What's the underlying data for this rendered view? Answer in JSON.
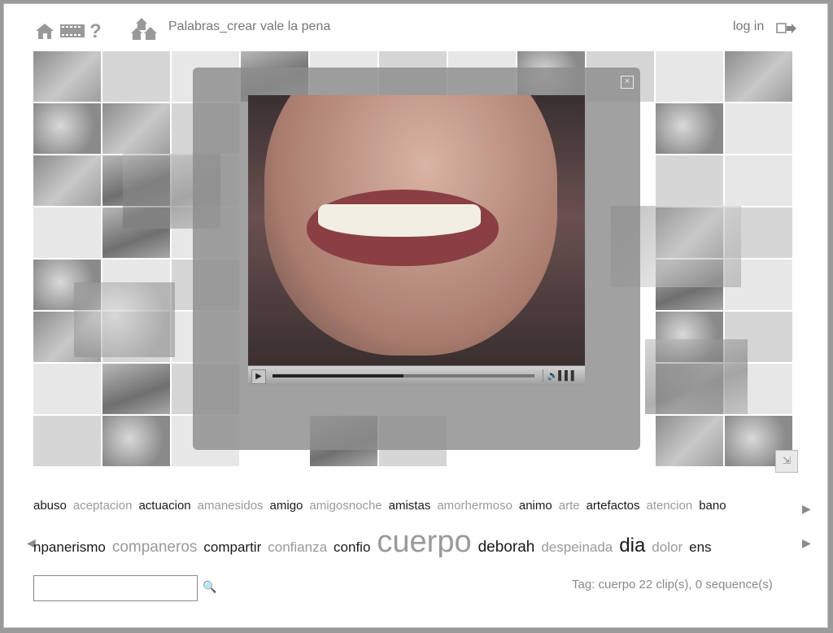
{
  "header": {
    "title": "Palabras_crear vale la pena",
    "login_label": "log in"
  },
  "icons": {
    "home": "home-icon",
    "film": "film-strip-icon",
    "help": "question-mark-icon",
    "community": "community-icon",
    "login": "login-arrow-icon",
    "close": "close-icon",
    "play": "play-icon",
    "volume": "volume-icon",
    "expand": "expand-icon",
    "search": "search-icon"
  },
  "player": {
    "close_label": "×",
    "progress": 0.5
  },
  "tags_row1": [
    {
      "text": "abuso",
      "tone": "dark"
    },
    {
      "text": "aceptacion",
      "tone": "mid"
    },
    {
      "text": "actuacion",
      "tone": "dark"
    },
    {
      "text": "amanesidos",
      "tone": "mid"
    },
    {
      "text": "amigo",
      "tone": "dark"
    },
    {
      "text": "amigosnoche",
      "tone": "mid"
    },
    {
      "text": "amistas",
      "tone": "dark"
    },
    {
      "text": "amorhermoso",
      "tone": "mid"
    },
    {
      "text": "animo",
      "tone": "dark"
    },
    {
      "text": "arte",
      "tone": "mid"
    },
    {
      "text": "artefactos",
      "tone": "dark"
    },
    {
      "text": "atencion",
      "tone": "mid"
    },
    {
      "text": "bano",
      "tone": "dark"
    }
  ],
  "tags_row2": [
    {
      "text": "npanerismo",
      "tone": "dark",
      "size": 17
    },
    {
      "text": "companeros",
      "tone": "mid",
      "size": 19
    },
    {
      "text": "compartir",
      "tone": "dark",
      "size": 17
    },
    {
      "text": "confianza",
      "tone": "mid",
      "size": 17
    },
    {
      "text": "confio",
      "tone": "dark",
      "size": 17
    },
    {
      "text": "cuerpo",
      "tone": "mid",
      "size": 38
    },
    {
      "text": "deborah",
      "tone": "dark",
      "size": 19
    },
    {
      "text": "despeinada",
      "tone": "mid",
      "size": 17
    },
    {
      "text": "dia",
      "tone": "dark",
      "size": 24
    },
    {
      "text": "dolor",
      "tone": "mid",
      "size": 17
    },
    {
      "text": "ens",
      "tone": "dark",
      "size": 17
    }
  ],
  "search": {
    "placeholder": ""
  },
  "status": {
    "text": "Tag: cuerpo 22 clip(s), 0 sequence(s)"
  },
  "colors": {
    "background": "#9a9a9a",
    "overlay": "#8c8c8c",
    "tag_dark": "#1a1a1a",
    "tag_mid": "#9a9a9a"
  }
}
